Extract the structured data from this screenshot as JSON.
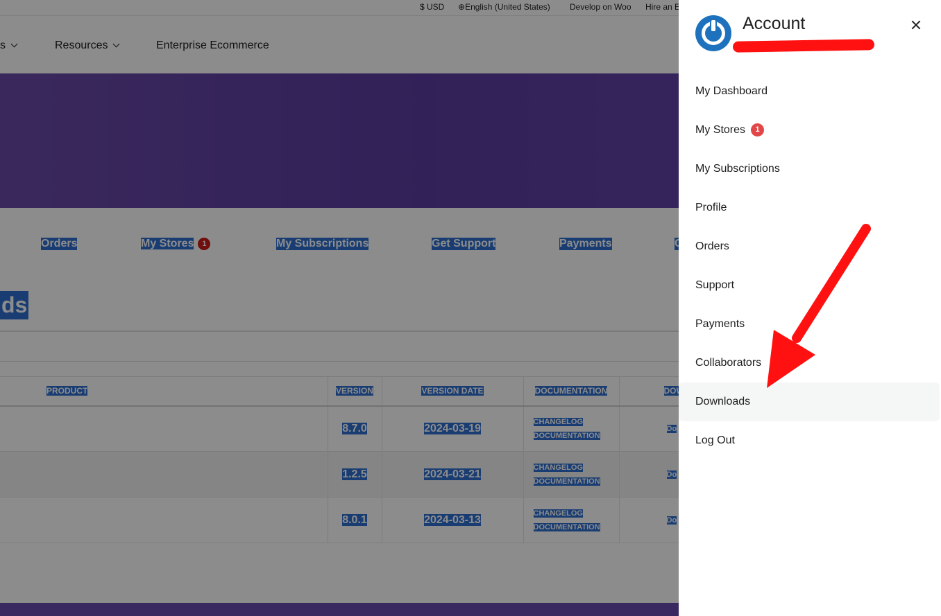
{
  "topbar": {
    "currency": "$ USD",
    "language": "English (United States)",
    "develop": "Develop on Woo",
    "hire": "Hire an E"
  },
  "nav": {
    "item_partial": "s",
    "resources": "Resources",
    "enterprise": "Enterprise Ecommerce"
  },
  "tabs": {
    "orders": "Orders",
    "my_stores": "My Stores",
    "my_stores_badge": "1",
    "subscriptions": "My Subscriptions",
    "support": "Get Support",
    "payments": "Payments",
    "partial": "C"
  },
  "heading_partial": "ds",
  "table": {
    "headers": [
      "PRODUCT",
      "VERSION",
      "VERSION DATE",
      "DOCUMENTATION",
      "DOW"
    ],
    "rows": [
      {
        "version": "8.7.0",
        "date": "2024-03-19",
        "changelog": "CHANGELOG",
        "documentation": "DOCUMENTATION",
        "download": "Do"
      },
      {
        "version": "1.2.5",
        "date": "2024-03-21",
        "changelog": "CHANGELOG",
        "documentation": "DOCUMENTATION",
        "download": "Do"
      },
      {
        "version": "8.0.1",
        "date": "2024-03-13",
        "changelog": "CHANGELOG",
        "documentation": "DOCUMENTATION",
        "download": "Do"
      }
    ]
  },
  "drawer": {
    "title": "Account",
    "menu": [
      {
        "label": "My Dashboard"
      },
      {
        "label": "My Stores",
        "badge": "1"
      },
      {
        "label": "My Subscriptions"
      },
      {
        "label": "Profile"
      },
      {
        "label": "Orders"
      },
      {
        "label": "Support"
      },
      {
        "label": "Payments"
      },
      {
        "label": "Collaborators"
      },
      {
        "label": "Downloads"
      },
      {
        "label": "Log Out"
      }
    ]
  },
  "colors": {
    "brand_purple": "#6b4ab0",
    "selection_blue": "#2f6fd0",
    "logo_blue": "#1e72bd",
    "badge_red": "#e34646",
    "annotation_red": "#ff1111"
  }
}
